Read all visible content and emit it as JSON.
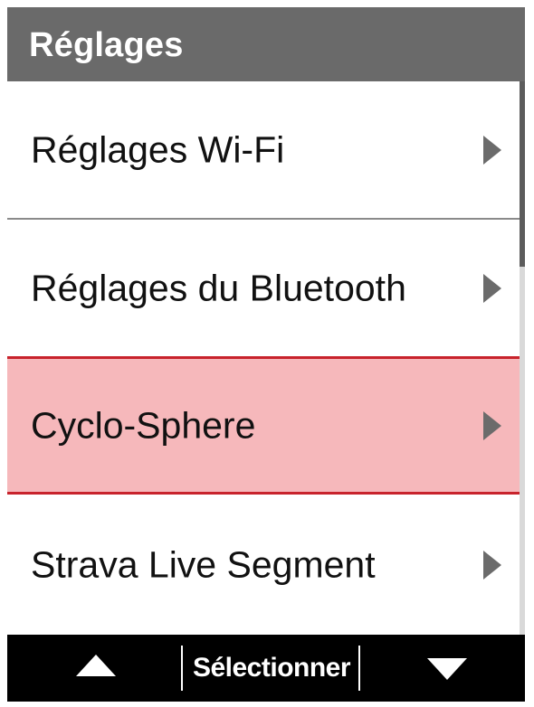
{
  "header": {
    "title": "Réglages"
  },
  "menu": {
    "items": [
      {
        "label": "Réglages Wi-Fi",
        "icon": "chevron-right-icon",
        "selected": false
      },
      {
        "label": "Réglages du Bluetooth",
        "icon": "chevron-right-icon",
        "selected": false
      },
      {
        "label": "Cyclo-Sphere",
        "icon": "chevron-right-icon",
        "selected": true
      },
      {
        "label": "Strava Live Segment",
        "icon": "chevron-right-icon",
        "selected": false
      }
    ]
  },
  "footer": {
    "up_icon": "triangle-up-icon",
    "select_label": "Sélectionner",
    "down_icon": "triangle-down-icon"
  },
  "colors": {
    "header_bg": "#6a6a6a",
    "selected_bg": "#f6b8bb",
    "selected_border": "#c8232c",
    "footer_bg": "#000000"
  }
}
